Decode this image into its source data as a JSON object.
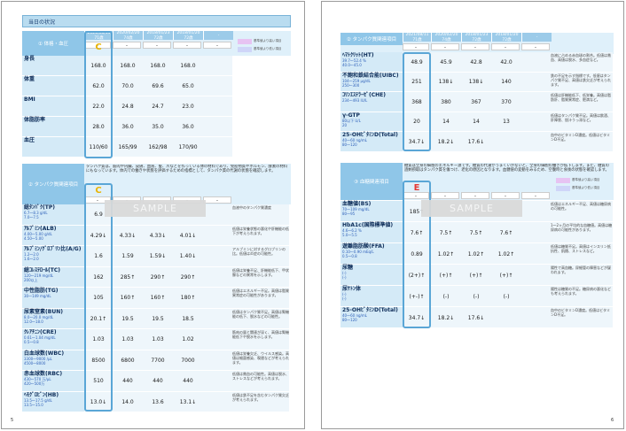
{
  "colors": {
    "header": "#b9dcf0",
    "label": "#d4eaf7",
    "accent": "#5aa6d6",
    "high": "#e7c3f2",
    "low": "#cfd5f8",
    "letter_left": "#e8b300",
    "letter_right": "#e53935"
  },
  "left": {
    "page_header": "当日の状況",
    "dates": [
      "2021/08/11\n71歳",
      "2020/02/20\n74歳",
      "2018/01/23\n72歳",
      "2018/01/20\n72歳",
      "-"
    ],
    "dashes": [
      "-",
      "-",
      "-",
      "-",
      "-"
    ],
    "legend": {
      "high": "基準値より高い項目",
      "low": "基準値より低い項目"
    },
    "sec1": {
      "label": "① 体格・血圧",
      "letter": "C",
      "rows": [
        {
          "name": "身長",
          "values": [
            "168.0",
            "168.0",
            "168.0",
            "168.0"
          ]
        },
        {
          "name": "体重",
          "values": [
            "62.0",
            "70.0",
            "69.6",
            "65.0"
          ]
        },
        {
          "name": "BMI",
          "values": [
            "22.0",
            "24.8",
            "24.7",
            "23.0"
          ]
        },
        {
          "name": "体脂肪率",
          "values": [
            "28.0",
            "36.0",
            "35.0",
            "36.0"
          ]
        },
        {
          "name": "血圧",
          "values": [
            "110/60",
            "165/99",
            "162/98",
            "170/90"
          ]
        }
      ]
    },
    "sec2": {
      "label": "② タンパク質関連項目",
      "letter": "C",
      "intro": "タンパク質は、筋肉や内臓、皮膚、血液、髪、爪などを作っている体の材料であり、免疫物質やホルモン、酵素の材料にもなっています。体内での働きや状態を評価するための指標として、タンパク質の代謝の状態を確認します。",
      "rows": [
        {
          "name": "総ﾀﾝﾊﾟｸ(TP)",
          "range": "6.7〜8.3 g/dL\n7.0〜7.5",
          "values": [
            "6.9",
            "",
            "",
            "",
            ""
          ],
          "comment": "血液中のタンパク質濃度"
        },
        {
          "name": "ｱﾙﾌﾞﾐﾝ(ALB)",
          "range": "4.00〜5.00 g/dL\n4.50〜5.00",
          "values": [
            "4.29↓",
            "4.33↓",
            "4.33↓",
            "4.01↓"
          ],
          "comment": "低値は栄養状態の悪化や肝機能の低下が考えられます。"
        },
        {
          "name": "ｱﾙﾌﾞﾐﾝ/ｸﾞﾛﾌﾞﾘﾝ比(A/G)",
          "range": "1.2〜2.0\n1.6〜2.0",
          "values": [
            "1.6",
            "1.59",
            "1.59↓",
            "1.40↓"
          ],
          "comment": "アルブミンに対するグロブリンの比。低値は炎症の可能性。"
        },
        {
          "name": "総ｺﾚｽﾃﾛｰﾙ(TC)",
          "range": "120〜219 mg/dL\n200以上",
          "values": [
            "162",
            "285↑",
            "290↑",
            "290↑"
          ],
          "comment": "低値は栄養不足、肝機能低下、甲状腺などの異常を示します。"
        },
        {
          "name": "中性脂肪(TG)",
          "range": "30〜149 mg/dL\n",
          "values": [
            "105",
            "160↑",
            "160↑",
            "180↑"
          ],
          "comment": "低値はエネルギー不足。高値は脂質異常症の可能性があります。"
        },
        {
          "name": "尿素窒素(BUN)",
          "range": "8.0〜20.0 mg/dL\n12.0〜18.0",
          "values": [
            "20.1↑",
            "19.5",
            "19.5",
            "18.5"
          ],
          "comment": "低値はタンパク質不足。高値は腎機能の低下、脱水などの可能性。"
        },
        {
          "name": "ｸﾚｱﾁﾆﾝ(CRE)",
          "range": "0.61〜1.04 mg/dL\n0.5〜0.8",
          "values": [
            "1.03",
            "1.03",
            "1.03",
            "1.02"
          ],
          "comment": "筋肉の量と関連が深く、高値は腎機能低下や脱水を示します。"
        },
        {
          "name": "白血球数(WBC)",
          "range": "3300〜9000 /μL\n4500〜8000",
          "values": [
            "8500",
            "6800",
            "7700",
            "7000"
          ],
          "comment": "低値は栄養欠乏、ウイルス感染。高値は細菌感染、喫煙などが考えられます。"
        },
        {
          "name": "赤血球数(RBC)",
          "range": "430〜570 万/μL\n420〜500万",
          "values": [
            "510",
            "440",
            "440",
            "440"
          ],
          "comment": "低値は貧血の可能性。高値は脱水、ストレスなどが考えられます。"
        },
        {
          "name": "ﾍﾓｸﾞﾛﾋﾞﾝ(HB)",
          "range": "13.5〜17.5 g/dL\n13.5〜15.0",
          "values": [
            "13.0↓",
            "14.0",
            "13.6",
            "13.1↓"
          ],
          "comment": "低値は鉄不足を含むタンパク質欠乏が考えられます。"
        }
      ]
    },
    "sample": "SAMPLE",
    "page_no": "5"
  },
  "right": {
    "sec2b": {
      "label": "② タンパク質関連項目",
      "rows": [
        {
          "name": "ﾍﾏﾄｸﾘｯﾄ(HT)",
          "range": "39.7〜52.4 %\n40.0〜45.0",
          "values": [
            "48.9",
            "45.9",
            "42.8",
            "42.0"
          ],
          "comment": "血液に占める赤血球の割合。低値は貧血、高値は脱水、多血症など。"
        },
        {
          "name": "不飽和鉄結合能(UIBC)",
          "range": "104〜259 μg/dL\n250〜300",
          "values": [
            "251",
            "138↓",
            "138↓",
            "140"
          ],
          "comment": "鉄の不足を示す指標です。低値はタンパク質不足、高値は鉄欠乏が考えられます。"
        },
        {
          "name": "ｺﾘﾝｴｽﾃﾗｰｾﾞ(CHE)",
          "range": "234〜493 IU/L\n",
          "values": [
            "368",
            "380",
            "367",
            "370"
          ],
          "comment": "低値は肝機能低下、低栄養。高値は脂肪肝、脂質異常症、肥満など。"
        },
        {
          "name": "γ-GTP",
          "range": "80以下 U/L\n20",
          "values": [
            "20",
            "14",
            "14",
            "13"
          ],
          "comment": "低値はタンパク質不足。高値は飲酒、肝障害、胆汁うっ滞など。"
        },
        {
          "name": "25-OHﾋﾞﾀﾐﾝD(Total)",
          "range": "40〜60 ng/mL\n80〜120",
          "values": [
            "34.7↓",
            "18.2↓",
            "17.6↓",
            ""
          ],
          "comment": "血中のビタミンD濃度。低値はビタミンD不足。"
        }
      ]
    },
    "dates": [
      "2021/08/11\n71歳",
      "2020/02/20\n74歳",
      "2018/01/23\n72歳",
      "2018/01/20\n72歳",
      "-"
    ],
    "dashes": [
      "-",
      "-",
      "-",
      "-",
      "-"
    ],
    "legend": {
      "high": "基準値より高い項目",
      "low": "基準値より低い項目"
    },
    "sec3": {
      "label": "③ 血糖関連項目",
      "letter": "E",
      "intro": "糖質は全身の細胞のエネルギー源です。糖質の代謝がうまくいかないと、全身の細胞の働きが低下します。また、糖質の過剰摂取はタンパク質を傷つけ、老化の原因となります。血糖値の変動をみるため、空腹時と食後の状態を確認します。",
      "rows": [
        {
          "name": "血糖値(BS)",
          "range": "70〜109 mg/dL\n80〜95",
          "values": [
            "185↑",
            "",
            "",
            "",
            ""
          ],
          "comment": "低値はエネルギー不足、高値は糖尿病の可能性。"
        },
        {
          "name": "HbA1c(国際標準値)",
          "range": "4.6〜6.2 %\n5.0〜5.5",
          "values": [
            "7.6↑",
            "7.5↑",
            "7.5↑",
            "7.6↑"
          ],
          "comment": "1〜2ヶ月の平均的な血糖値。高値は糖尿病の可能性があります。"
        },
        {
          "name": "遊離脂肪酸(FFA)",
          "range": "0.10〜0.90 mEq/L\n0.5〜0.8",
          "values": [
            "0.89",
            "1.02↑",
            "1.02↑",
            "1.02↑"
          ],
          "comment": "低値は糖質不足。高値はインスリン抵抗性、飢餓、ストレスなど。"
        },
        {
          "name": "尿糖",
          "range": "(-)\n(-)",
          "values": [
            "(2+)↑",
            "(+)↑",
            "(+)↑",
            "(+)↑"
          ],
          "comment": "陽性で高血糖。尿細管の障害などが疑われます。"
        },
        {
          "name": "尿ｹﾄﾝ体",
          "range": "(-)\n(-)",
          "values": [
            "(+-)↑",
            "(-)",
            "(-)",
            "(-)"
          ],
          "comment": "陽性は糖質の不足。糖尿病の悪化なども考えられます。"
        },
        {
          "name": "25-OHﾋﾞﾀﾐﾝD(Total)",
          "range": "40〜60 ng/mL\n80〜120",
          "values": [
            "34.7↓",
            "18.2↓",
            "17.6↓",
            ""
          ],
          "comment": "血中のビタミンD濃度。低値はビタミンD不足。"
        }
      ]
    },
    "sample": "SAMPLE",
    "page_no": "6"
  }
}
